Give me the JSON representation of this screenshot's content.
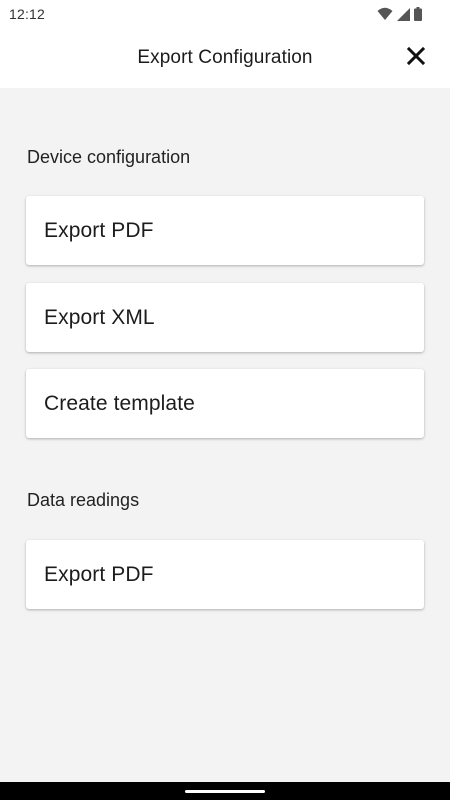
{
  "status_bar": {
    "time": "12:12",
    "icons": [
      "wifi-icon",
      "cell-signal-icon",
      "battery-icon"
    ]
  },
  "app_bar": {
    "title": "Export Configuration",
    "close_icon": "close-icon"
  },
  "sections": [
    {
      "header": "Device configuration",
      "items": [
        {
          "label": "Export PDF"
        },
        {
          "label": "Export XML"
        },
        {
          "label": "Create template"
        }
      ]
    },
    {
      "header": "Data readings",
      "items": [
        {
          "label": "Export PDF"
        }
      ]
    }
  ],
  "colors": {
    "background": "#f3f3f3",
    "surface": "#ffffff",
    "text": "#1c1c1c",
    "nav_bar": "#000000"
  }
}
